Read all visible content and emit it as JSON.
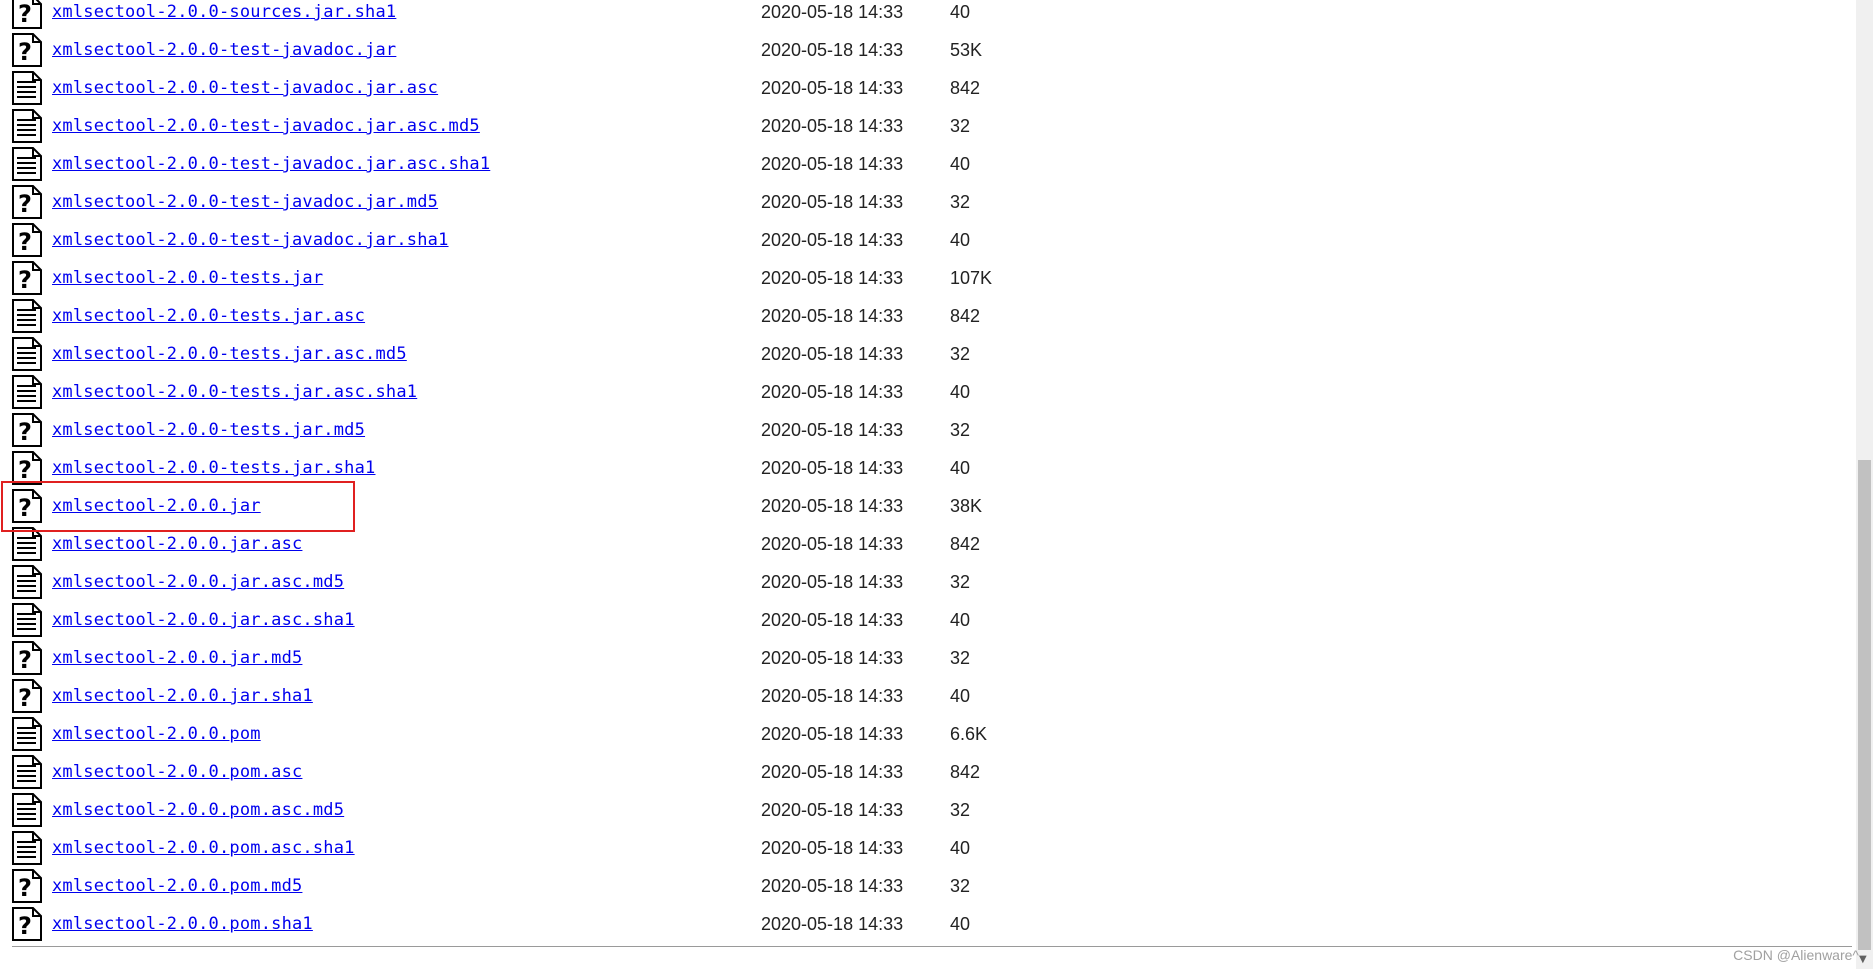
{
  "listing": {
    "rows": [
      {
        "name": "xmlsectool-2.0.0-sources.jar.sha1",
        "date": "2020-05-18 14:33",
        "size": "40",
        "icon": "unknown-file-icon"
      },
      {
        "name": "xmlsectool-2.0.0-test-javadoc.jar",
        "date": "2020-05-18 14:33",
        "size": "53K",
        "icon": "unknown-file-icon"
      },
      {
        "name": "xmlsectool-2.0.0-test-javadoc.jar.asc",
        "date": "2020-05-18 14:33",
        "size": "842",
        "icon": "text-file-icon"
      },
      {
        "name": "xmlsectool-2.0.0-test-javadoc.jar.asc.md5",
        "date": "2020-05-18 14:33",
        "size": "32",
        "icon": "text-file-icon"
      },
      {
        "name": "xmlsectool-2.0.0-test-javadoc.jar.asc.sha1",
        "date": "2020-05-18 14:33",
        "size": "40",
        "icon": "text-file-icon"
      },
      {
        "name": "xmlsectool-2.0.0-test-javadoc.jar.md5",
        "date": "2020-05-18 14:33",
        "size": "32",
        "icon": "unknown-file-icon"
      },
      {
        "name": "xmlsectool-2.0.0-test-javadoc.jar.sha1",
        "date": "2020-05-18 14:33",
        "size": "40",
        "icon": "unknown-file-icon"
      },
      {
        "name": "xmlsectool-2.0.0-tests.jar",
        "date": "2020-05-18 14:33",
        "size": "107K",
        "icon": "unknown-file-icon"
      },
      {
        "name": "xmlsectool-2.0.0-tests.jar.asc",
        "date": "2020-05-18 14:33",
        "size": "842",
        "icon": "text-file-icon"
      },
      {
        "name": "xmlsectool-2.0.0-tests.jar.asc.md5",
        "date": "2020-05-18 14:33",
        "size": "32",
        "icon": "text-file-icon"
      },
      {
        "name": "xmlsectool-2.0.0-tests.jar.asc.sha1",
        "date": "2020-05-18 14:33",
        "size": "40",
        "icon": "text-file-icon"
      },
      {
        "name": "xmlsectool-2.0.0-tests.jar.md5",
        "date": "2020-05-18 14:33",
        "size": "32",
        "icon": "unknown-file-icon"
      },
      {
        "name": "xmlsectool-2.0.0-tests.jar.sha1",
        "date": "2020-05-18 14:33",
        "size": "40",
        "icon": "unknown-file-icon"
      },
      {
        "name": "xmlsectool-2.0.0.jar",
        "date": "2020-05-18 14:33",
        "size": "38K",
        "icon": "unknown-file-icon"
      },
      {
        "name": "xmlsectool-2.0.0.jar.asc",
        "date": "2020-05-18 14:33",
        "size": "842",
        "icon": "text-file-icon"
      },
      {
        "name": "xmlsectool-2.0.0.jar.asc.md5",
        "date": "2020-05-18 14:33",
        "size": "32",
        "icon": "text-file-icon"
      },
      {
        "name": "xmlsectool-2.0.0.jar.asc.sha1",
        "date": "2020-05-18 14:33",
        "size": "40",
        "icon": "text-file-icon"
      },
      {
        "name": "xmlsectool-2.0.0.jar.md5",
        "date": "2020-05-18 14:33",
        "size": "32",
        "icon": "unknown-file-icon"
      },
      {
        "name": "xmlsectool-2.0.0.jar.sha1",
        "date": "2020-05-18 14:33",
        "size": "40",
        "icon": "unknown-file-icon"
      },
      {
        "name": "xmlsectool-2.0.0.pom",
        "date": "2020-05-18 14:33",
        "size": "6.6K",
        "icon": "text-file-icon"
      },
      {
        "name": "xmlsectool-2.0.0.pom.asc",
        "date": "2020-05-18 14:33",
        "size": "842",
        "icon": "text-file-icon"
      },
      {
        "name": "xmlsectool-2.0.0.pom.asc.md5",
        "date": "2020-05-18 14:33",
        "size": "32",
        "icon": "text-file-icon"
      },
      {
        "name": "xmlsectool-2.0.0.pom.asc.sha1",
        "date": "2020-05-18 14:33",
        "size": "40",
        "icon": "text-file-icon"
      },
      {
        "name": "xmlsectool-2.0.0.pom.md5",
        "date": "2020-05-18 14:33",
        "size": "32",
        "icon": "unknown-file-icon"
      },
      {
        "name": "xmlsectool-2.0.0.pom.sha1",
        "date": "2020-05-18 14:33",
        "size": "40",
        "icon": "unknown-file-icon"
      }
    ],
    "highlighted_file": "xmlsectool-2.0.0.jar",
    "highlight_color": "#e02020"
  },
  "colors": {
    "link": "#0000ee",
    "text": "#222222"
  },
  "watermark": {
    "text": "CSDN @Alienware^"
  }
}
